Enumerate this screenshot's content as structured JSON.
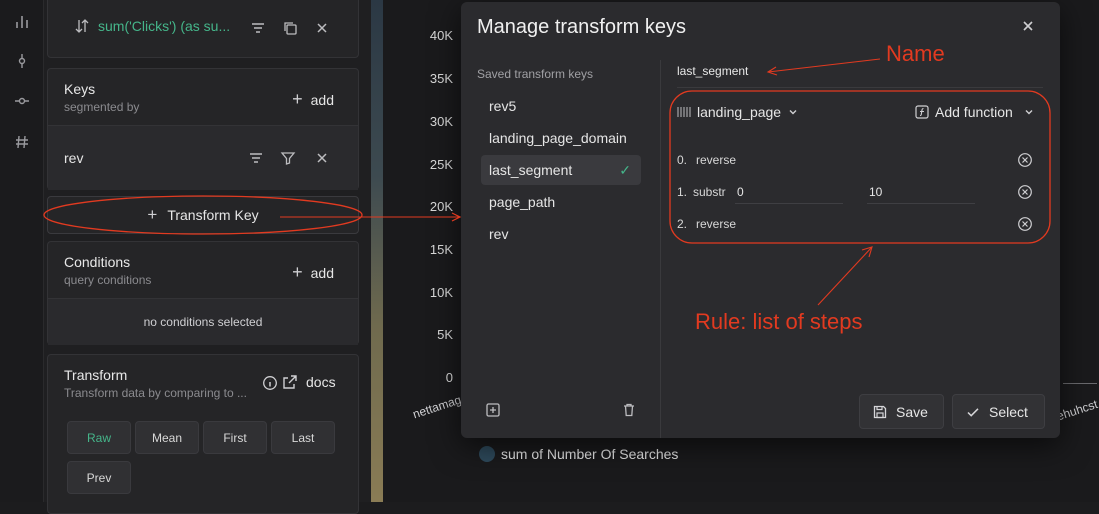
{
  "sidebar_top": {
    "metric_label": "sum('Clicks') (as su..."
  },
  "keys": {
    "title": "Keys",
    "subtitle": "segmented by",
    "add_label": "add",
    "key_value": "rev"
  },
  "transform_key": {
    "label": "Transform Key"
  },
  "conditions": {
    "title": "Conditions",
    "subtitle": "query conditions",
    "add_label": "add",
    "empty_text": "no conditions selected"
  },
  "transform": {
    "title": "Transform",
    "subtitle": "Transform data by comparing to ...",
    "docs_label": "docs",
    "buttons": [
      "Raw",
      "Mean",
      "First",
      "Last",
      "Prev"
    ]
  },
  "chart": {
    "y_ticks": [
      "40K",
      "35K",
      "30K",
      "25K",
      "20K",
      "15K",
      "10K",
      "5K",
      "0"
    ],
    "x_left_label": "nettamag",
    "x_right_label": "ehuhcst",
    "legend_label": "sum of Number Of Searches"
  },
  "modal": {
    "title": "Manage transform keys",
    "saved_label": "Saved transform keys",
    "saved_keys": [
      "rev5",
      "landing_page_domain",
      "last_segment",
      "page_path",
      "rev"
    ],
    "selected_index": 2,
    "name_value": "last_segment",
    "key_field": "landing_page",
    "add_function_label": "Add function",
    "steps": [
      {
        "index": "0.",
        "name": "reverse"
      },
      {
        "index": "1.",
        "name": "substr",
        "arg1": "0",
        "arg2": "10"
      },
      {
        "index": "2.",
        "name": "reverse"
      }
    ],
    "save_label": "Save",
    "select_label": "Select"
  },
  "annotations": {
    "name_label": "Name",
    "rule_label": "Rule: list of steps"
  },
  "colors": {
    "accent_green": "#45b58a",
    "annotation_red": "#e23a20"
  }
}
